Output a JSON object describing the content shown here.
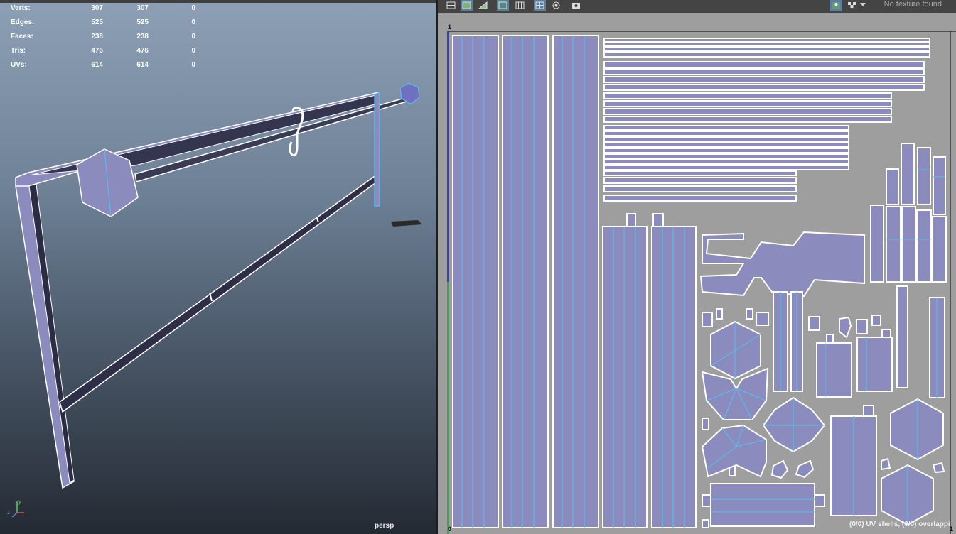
{
  "viewport": {
    "hud": [
      {
        "label": "Verts:",
        "c1": "307",
        "c2": "307",
        "c3": "0"
      },
      {
        "label": "Edges:",
        "c1": "525",
        "c2": "525",
        "c3": "0"
      },
      {
        "label": "Faces:",
        "c1": "238",
        "c2": "238",
        "c3": "0"
      },
      {
        "label": "Tris:",
        "c1": "476",
        "c2": "476",
        "c3": "0"
      },
      {
        "label": "UVs:",
        "c1": "614",
        "c2": "614",
        "c3": "0"
      }
    ],
    "camera": "persp",
    "axis": {
      "x": "x",
      "y": "y",
      "z": "z"
    }
  },
  "uv_editor": {
    "texture_status": "No texture found",
    "axis_top": "1",
    "axis_origin": "0",
    "axis_right": "1",
    "status": "(0/0) UV shells, (0/0) overlappi",
    "colors": {
      "shell_fill": "#8b8cbd",
      "shell_border": "#ffffff",
      "seam": "#4fc3f7",
      "background": "#9e9e9e"
    }
  }
}
